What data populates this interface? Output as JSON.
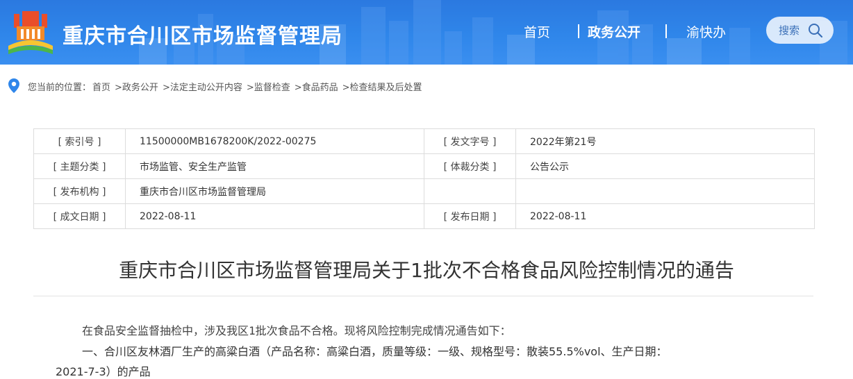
{
  "header": {
    "site_title": "重庆市合川区市场监督管理局",
    "nav": {
      "home": "首页",
      "active": "政务公开",
      "yukuai": "渝快办"
    },
    "search_label": "搜索",
    "colors": {
      "header_bg": "#2f86ea",
      "text": "#ffffff"
    },
    "icons": {
      "logo": "government-building-logo",
      "search": "search-icon"
    }
  },
  "breadcrumb": {
    "prefix": "您当前的位置：",
    "items": [
      "首页",
      ">政务公开",
      ">法定主动公开内容",
      ">监督检查",
      ">食品药品",
      ">检查结果及后处置"
    ],
    "icon": "location-pin-icon"
  },
  "info": {
    "rows": [
      {
        "k1": "[ 索引号 ]",
        "v1": "11500000MB1678200K/2022-00275",
        "k2": "[ 发文字号 ]",
        "v2": "2022年第21号"
      },
      {
        "k1": "[ 主题分类 ]",
        "v1": "市场监管、安全生产监管",
        "k2": "[ 体裁分类 ]",
        "v2": "公告公示"
      },
      {
        "k1": "[ 发布机构 ]",
        "v1": "重庆市合川区市场监督管理局",
        "k2": "",
        "v2": ""
      },
      {
        "k1": "[ 成文日期 ]",
        "v1": "2022-08-11",
        "k2": "[ 发布日期 ]",
        "v2": "2022-08-11"
      }
    ]
  },
  "article": {
    "title": "重庆市合川区市场监督管理局关于1批次不合格食品风险控制情况的通告",
    "para1": "在食品安全监督抽检中，涉及我区1批次食品不合格。现将风险控制完成情况通告如下：",
    "para2": "一、合川区友林酒厂生产的高粱白酒（产品名称：高粱白酒，质量等级：一级、规格型号：散装55.5%vol、生产日期：",
    "para3": "2021-7-3）的产品"
  }
}
